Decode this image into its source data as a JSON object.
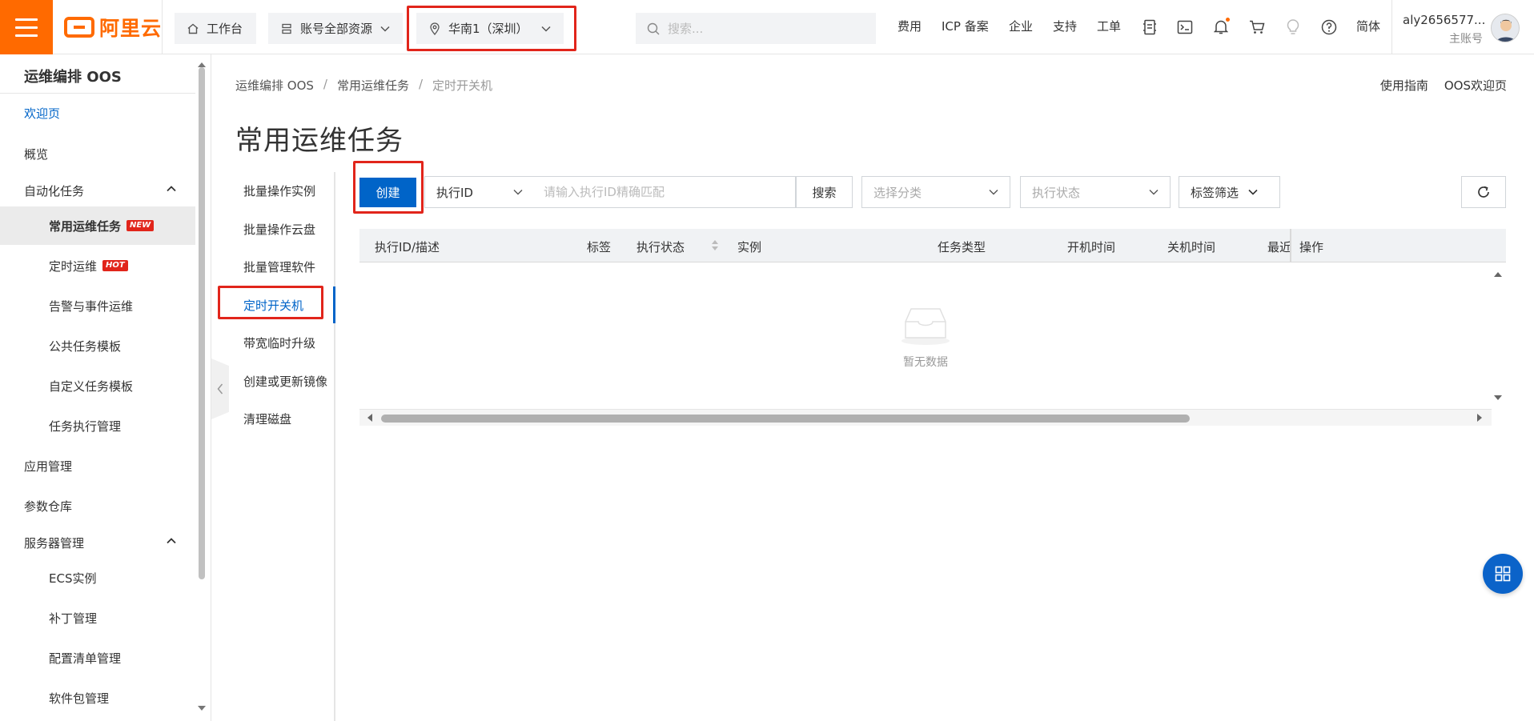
{
  "topbar": {
    "logo_text": "阿里云",
    "workbench": "工作台",
    "resources": "账号全部资源",
    "region": "华南1（深圳）",
    "search_placeholder": "搜索...",
    "nav": [
      "费用",
      "ICP 备案",
      "企业",
      "支持",
      "工单"
    ],
    "language": "简体",
    "account_name": "aly2656577...",
    "account_role": "主账号"
  },
  "sidebar": {
    "title": "运维编排 OOS",
    "items": [
      {
        "label": "欢迎页",
        "level": 1,
        "state": "selected"
      },
      {
        "label": "概览",
        "level": 1
      },
      {
        "label": "自动化任务",
        "level": 1,
        "expanded": true
      },
      {
        "label": "常用运维任务",
        "level": 2,
        "tag": "NEW",
        "state": "active"
      },
      {
        "label": "定时运维",
        "level": 2,
        "tag": "HOT"
      },
      {
        "label": "告警与事件运维",
        "level": 2
      },
      {
        "label": "公共任务模板",
        "level": 2
      },
      {
        "label": "自定义任务模板",
        "level": 2
      },
      {
        "label": "任务执行管理",
        "level": 2
      },
      {
        "label": "应用管理",
        "level": 1
      },
      {
        "label": "参数仓库",
        "level": 1
      },
      {
        "label": "服务器管理",
        "level": 1,
        "expanded": true
      },
      {
        "label": "ECS实例",
        "level": 2
      },
      {
        "label": "补丁管理",
        "level": 2
      },
      {
        "label": "配置清单管理",
        "level": 2
      },
      {
        "label": "软件包管理",
        "level": 2
      }
    ]
  },
  "breadcrumb": [
    "运维编排 OOS",
    "常用运维任务",
    "定时开关机"
  ],
  "top_links": [
    "使用指南",
    "OOS欢迎页"
  ],
  "page_title": "常用运维任务",
  "subnav": [
    "批量操作实例",
    "批量操作云盘",
    "批量管理软件",
    "定时开关机",
    "带宽临时升级",
    "创建或更新镜像",
    "清理磁盘"
  ],
  "subnav_active": "定时开关机",
  "toolbar": {
    "create": "创建",
    "field_select": "执行ID",
    "exec_placeholder": "请输入执行ID精确匹配",
    "search": "搜索",
    "category_placeholder": "选择分类",
    "status_placeholder": "执行状态",
    "tag_filter": "标签筛选"
  },
  "table": {
    "columns": [
      "执行ID/描述",
      "标签",
      "执行状态",
      "实例",
      "任务类型",
      "开机时间",
      "关机时间",
      "最近",
      "操作"
    ],
    "empty_text": "暂无数据"
  },
  "colors": {
    "brand": "#ff6a00",
    "primary": "#0064c8",
    "highlight": "#e1251b"
  }
}
